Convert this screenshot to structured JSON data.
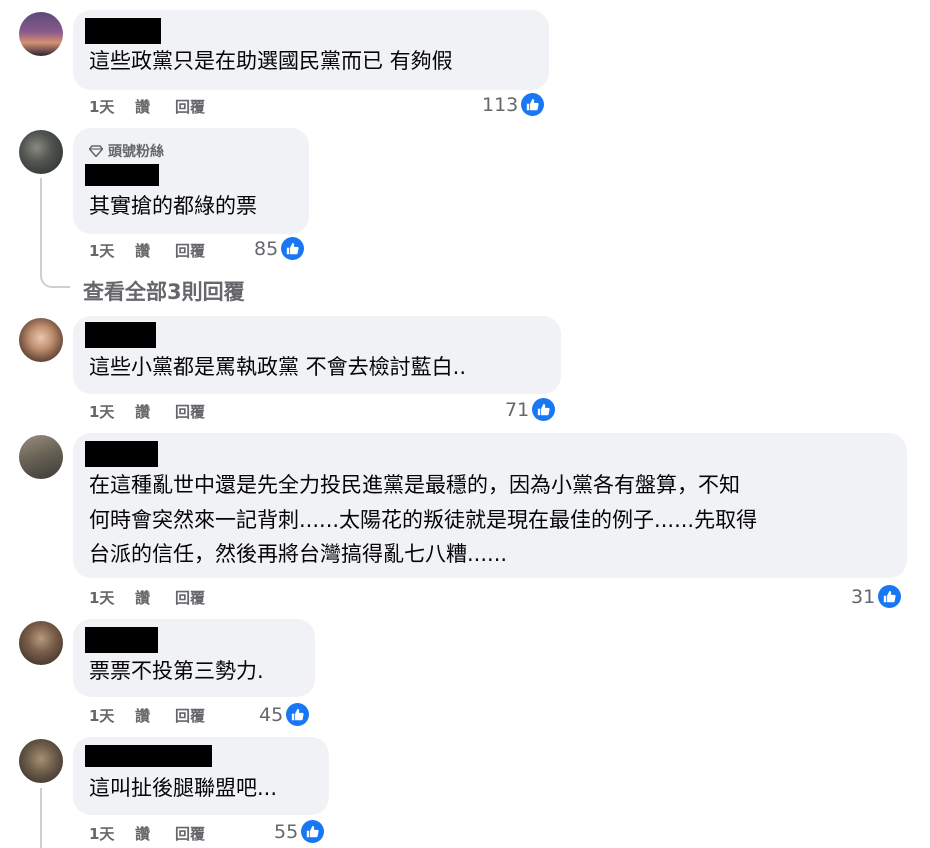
{
  "comments": [
    {
      "text_lines": [
        "這些政黨只是在助選國民黨而已 有夠假"
      ],
      "time": "1天",
      "like_label": "讚",
      "reply_label": "回覆",
      "reactions": "113"
    },
    {
      "badge": "頭號粉絲",
      "text_lines": [
        "其實搶的都綠的票"
      ],
      "time": "1天",
      "like_label": "讚",
      "reply_label": "回覆",
      "reactions": "85"
    },
    {
      "text_lines": [
        "這些小黨都是罵執政黨 不會去檢討藍白.."
      ],
      "time": "1天",
      "like_label": "讚",
      "reply_label": "回覆",
      "reactions": "71"
    },
    {
      "text_lines": [
        "在這種亂世中還是先全力投民進黨是最穩的，因為小黨各有盤算，不知",
        "何時會突然來一記背刺......太陽花的叛徒就是現在最佳的例子......先取得",
        "台派的信任，然後再將台灣搞得亂七八糟......"
      ],
      "time": "1天",
      "like_label": "讚",
      "reply_label": "回覆",
      "reactions": "31"
    },
    {
      "text_lines": [
        "票票不投第三勢力."
      ],
      "time": "1天",
      "like_label": "讚",
      "reply_label": "回覆",
      "reactions": "45"
    },
    {
      "text_lines": [
        "這叫扯後腿聯盟吧..."
      ],
      "time": "1天",
      "like_label": "讚",
      "reply_label": "回覆",
      "reactions": "55"
    }
  ],
  "view_replies": "查看全部3則回覆",
  "colors": {
    "bubble": "#f0f2f5",
    "meta": "#65676b",
    "like_blue": "#1877f2"
  },
  "icons": {
    "reaction": "thumbs-up-icon",
    "badge": "diamond-icon"
  }
}
